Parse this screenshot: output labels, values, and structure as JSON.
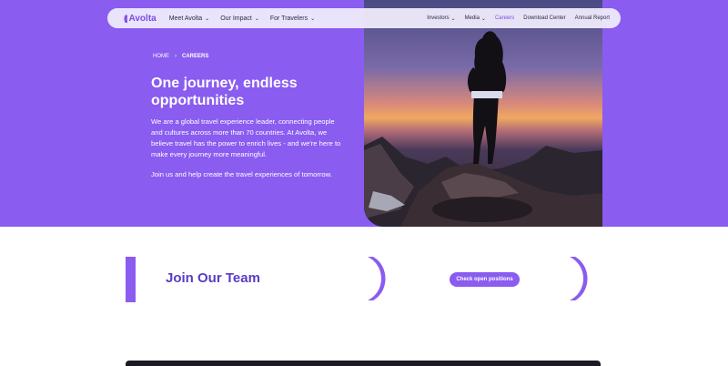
{
  "nav": {
    "logo": "Avolta",
    "main": [
      "Meet Avolta",
      "Our Impact",
      "For Travelers"
    ],
    "right": [
      {
        "label": "Investors",
        "chevron": true,
        "active": false
      },
      {
        "label": "Media",
        "chevron": true,
        "active": false
      },
      {
        "label": "Careers",
        "chevron": false,
        "active": true
      },
      {
        "label": "Download Center",
        "chevron": false,
        "active": false
      },
      {
        "label": "Annual Report",
        "chevron": false,
        "active": false
      }
    ]
  },
  "breadcrumb": {
    "home": "HOME",
    "separator": "›",
    "current": "CAREERS"
  },
  "hero": {
    "title": "One journey, endless opportunities",
    "paragraph1": "We are a global travel experience leader, connecting people and cultures across more than 70 countries. At Avolta, we believe travel has the power to enrich lives - and we're here to make every journey more meaningful.",
    "paragraph2": "Join us and help create the travel experiences of tomorrow."
  },
  "join": {
    "title": "Join Our Team",
    "cta": "Check open positions"
  },
  "colors": {
    "brand": "#8a5cf0",
    "brand_dark": "#5b3cc4",
    "active_link": "#7a4ee8"
  }
}
